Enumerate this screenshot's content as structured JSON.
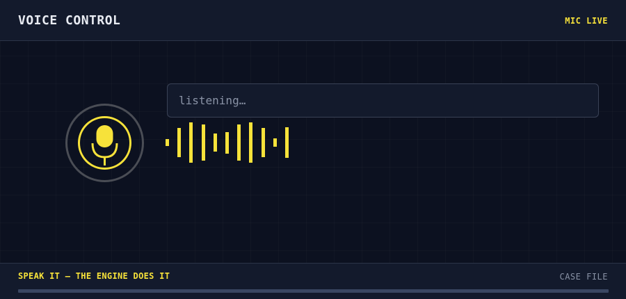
{
  "header": {
    "title": "VOICE CONTROL",
    "mic_status": "MIC LIVE"
  },
  "mic": {
    "icon": "microphone-icon"
  },
  "transcript": {
    "placeholder": "listening…",
    "value": ""
  },
  "waveform": {
    "levels": [
      0.17,
      0.67,
      0.94,
      0.83,
      0.42,
      0.5,
      0.83,
      0.94,
      0.67,
      0.19,
      0.7
    ]
  },
  "footer": {
    "tagline": "SPEAK IT — THE ENGINE DOES IT",
    "case_file_label": "CASE FILE"
  },
  "colors": {
    "accent": "#f7e23a",
    "background": "#0c1120",
    "panel": "#131a2c"
  }
}
